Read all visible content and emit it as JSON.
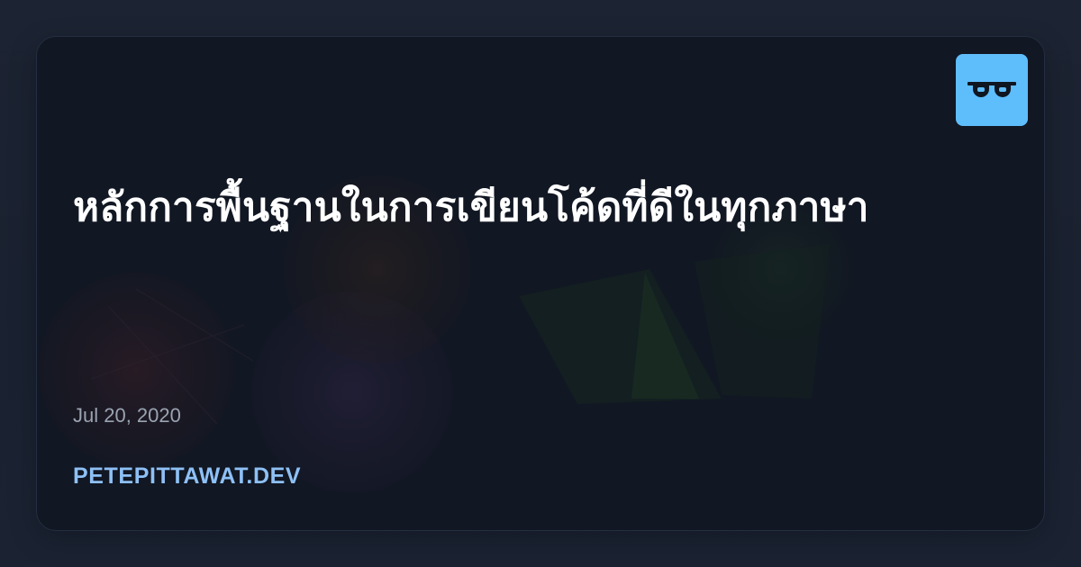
{
  "post": {
    "title": "หลักการพื้นฐานในการเขียนโค้ดที่ดีในทุกภาษา",
    "date": "Jul 20, 2020"
  },
  "site": {
    "name": "PETEPITTAWAT.DEV"
  },
  "logo": {
    "icon": "glasses-logo-icon",
    "background_color": "#5ebdfb"
  },
  "colors": {
    "page_background": "#1a2130",
    "card_background": "#111723",
    "title_text": "#ffffff",
    "date_text": "#9aa3b2",
    "site_text": "#8ec0f5"
  }
}
